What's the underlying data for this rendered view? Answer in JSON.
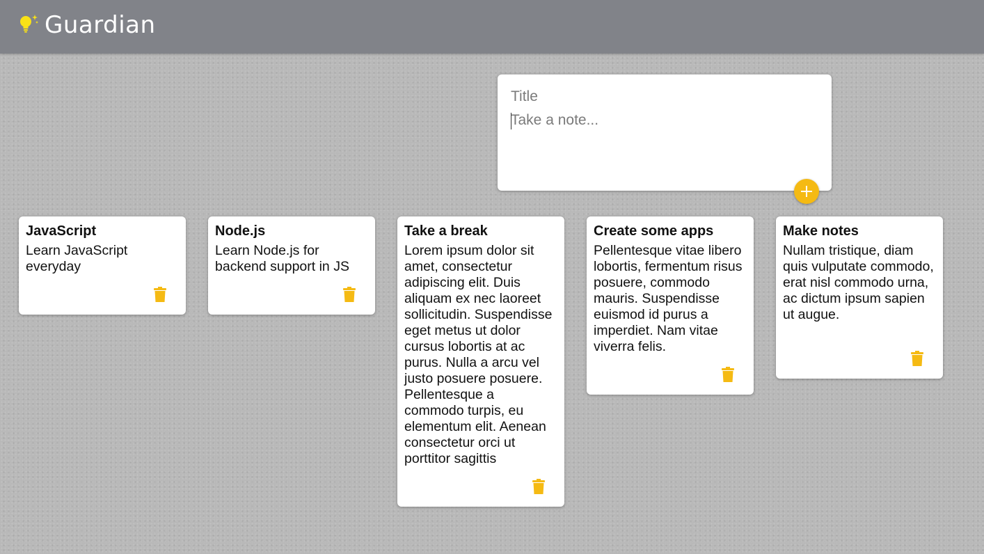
{
  "app": {
    "title": "Guardian",
    "logo_icon": "lightbulb-icon"
  },
  "create_area": {
    "title_placeholder": "Title",
    "content_placeholder": "Take a note...",
    "add_icon": "plus-icon"
  },
  "notes": [
    {
      "title": "JavaScript",
      "content": "Learn JavaScript everyday",
      "delete_icon": "trash-icon"
    },
    {
      "title": "Node.js",
      "content": "Learn Node.js for backend support in JS",
      "delete_icon": "trash-icon"
    },
    {
      "title": "Take a break",
      "content": "Lorem ipsum dolor sit amet, consectetur adipiscing elit. Duis aliquam ex nec laoreet sollicitudin. Suspendisse eget metus ut dolor cursus lobortis at ac purus. Nulla a arcu vel justo posuere posuere. Pellentesque a commodo turpis, eu elementum elit. Aenean consectetur orci ut porttitor sagittis",
      "delete_icon": "trash-icon"
    },
    {
      "title": "Create some apps",
      "content": "Pellentesque vitae libero lobortis, fermentum risus posuere, commodo mauris. Suspendisse euismod id purus a imperdiet. Nam vitae viverra felis.",
      "delete_icon": "trash-icon"
    },
    {
      "title": "Make notes",
      "content": "Nullam tristique, diam quis vulputate commodo, erat nisl commodo urna, ac dictum ipsum sapien ut augue.",
      "delete_icon": "trash-icon"
    }
  ],
  "colors": {
    "header_bg": "#818389",
    "accent": "#f5ba13",
    "logo_bulb": "#f9e216",
    "card_bg": "#ffffff"
  }
}
